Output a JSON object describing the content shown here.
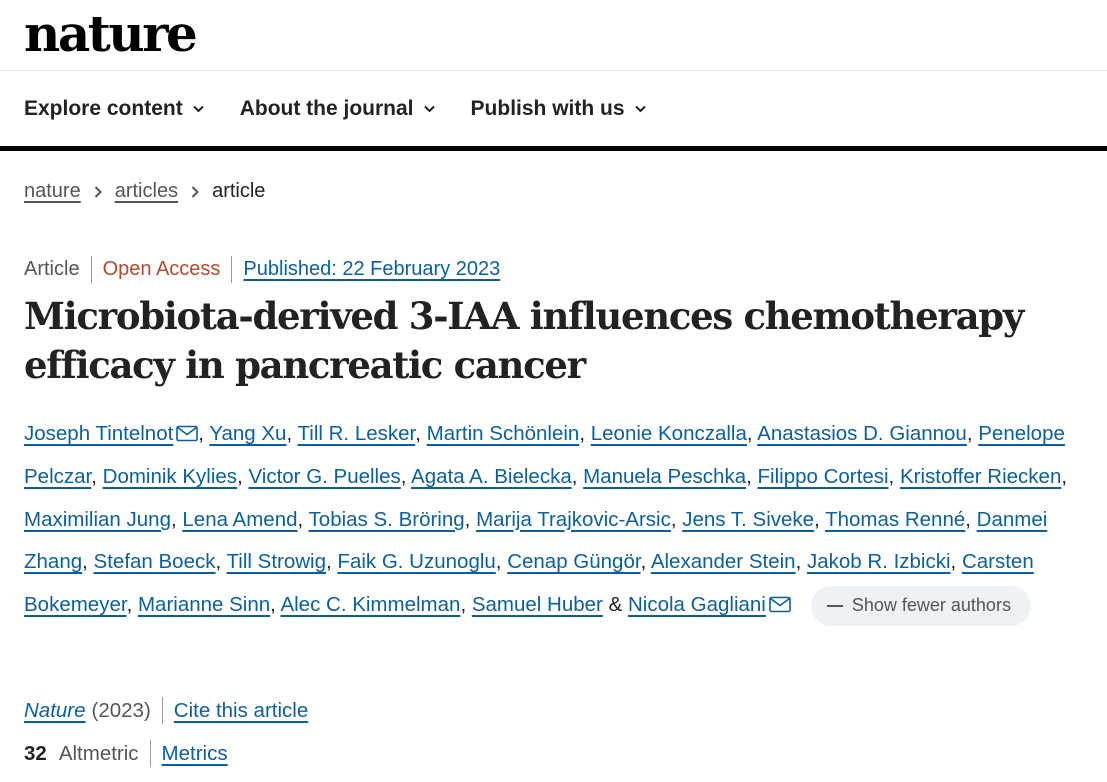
{
  "site": {
    "logo": "nature"
  },
  "nav": {
    "explore": "Explore content",
    "about": "About the journal",
    "publish": "Publish with us"
  },
  "breadcrumb": {
    "home": "nature",
    "section": "articles",
    "current": "article"
  },
  "article": {
    "type": "Article",
    "access": "Open Access",
    "published": "Published: 22 February 2023",
    "title": "Microbiota-derived 3-IAA influences chemotherapy efficacy in pancreatic cancer"
  },
  "authors": [
    "Joseph Tintelnot",
    "Yang Xu",
    "Till R. Lesker",
    "Martin Schönlein",
    "Leonie Konczalla",
    "Anastasios D. Giannou",
    "Penelope Pelczar",
    "Dominik Kylies",
    "Victor G. Puelles",
    "Agata A. Bielecka",
    "Manuela Peschka",
    "Filippo Cortesi",
    "Kristoffer Riecken",
    "Maximilian Jung",
    "Lena Amend",
    "Tobias S. Bröring",
    "Marija Trajkovic-Arsic",
    "Jens T. Siveke",
    "Thomas Renné",
    "Danmei Zhang",
    "Stefan Boeck",
    "Till Strowig",
    "Faik G. Uzunoglu",
    "Cenap Güngör",
    "Alexander Stein",
    "Jakob R. Izbicki",
    "Carsten Bokemeyer",
    "Marianne Sinn",
    "Alec C. Kimmelman",
    "Samuel Huber",
    "Nicola Gagliani"
  ],
  "authors_ui": {
    "show_fewer": "Show fewer authors",
    "conjunction": "&",
    "separator": ", "
  },
  "citation": {
    "journal": "Nature",
    "year": "(2023)",
    "cite_label": "Cite this article"
  },
  "metrics": {
    "altmetric_count": "32",
    "altmetric_label": "Altmetric",
    "metrics_label": "Metrics"
  },
  "colors": {
    "link": "#0c5f9c",
    "open_access": "#b24b2e",
    "muted": "#555555",
    "chip_bg": "#eef1f5"
  }
}
